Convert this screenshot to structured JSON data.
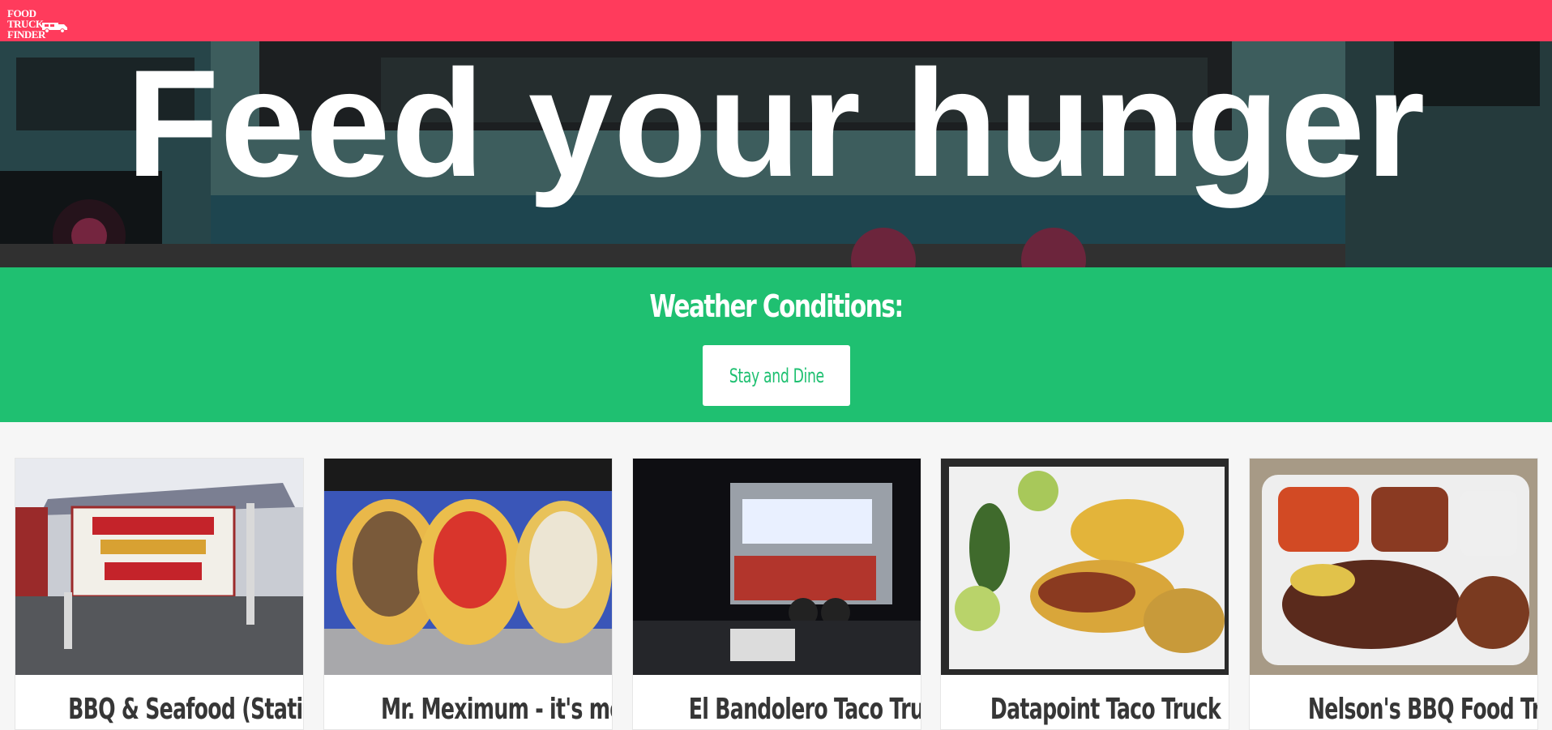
{
  "navbar": {
    "logo_line1": "FOOD TRUCK",
    "logo_line2": "FINDER",
    "brand_color": "#ff3b5c"
  },
  "hero": {
    "title": "Feed your hunger"
  },
  "weather": {
    "title": "Weather Conditions:",
    "button_label": "Stay and Dine",
    "accent_color": "#1fc071"
  },
  "trucks": [
    {
      "name": "BBQ & Seafood (Static"
    },
    {
      "name": "Mr. Meximum - it's more"
    },
    {
      "name": "El Bandolero Taco Truck"
    },
    {
      "name": "Datapoint Taco Truck"
    },
    {
      "name": "Nelson's BBQ Food Truck"
    }
  ]
}
